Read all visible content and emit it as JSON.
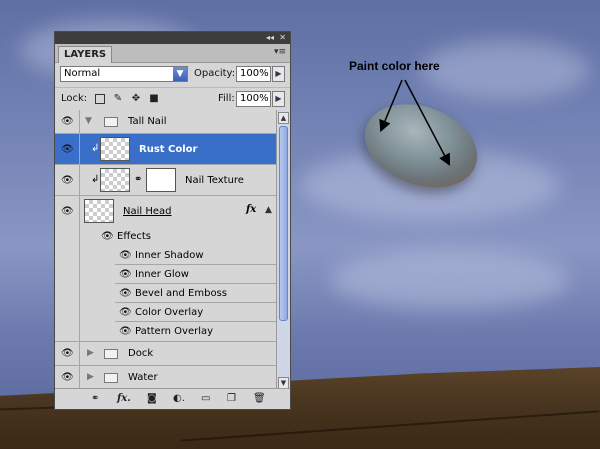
{
  "panel": {
    "tab_label": "LAYERS",
    "blend_mode": "Normal",
    "opacity_label": "Opacity:",
    "opacity_value": "100%",
    "lock_label": "Lock:",
    "fill_label": "Fill:",
    "fill_value": "100%"
  },
  "layers": {
    "group_tall_nail": "Tall Nail",
    "rust_color": "Rust Color",
    "nail_texture": "Nail Texture",
    "nail_head": "Nail Head",
    "fx": "fx",
    "effects_label": "Effects",
    "effects": [
      "Inner Shadow",
      "Inner Glow",
      "Bevel and Emboss",
      "Color Overlay",
      "Pattern Overlay"
    ],
    "group_dock": "Dock",
    "group_water": "Water"
  },
  "canvas": {
    "annotation": "Paint color here"
  },
  "colors": {
    "selection": "#3a6fc9",
    "panel_bg": "#d6d6d6"
  }
}
